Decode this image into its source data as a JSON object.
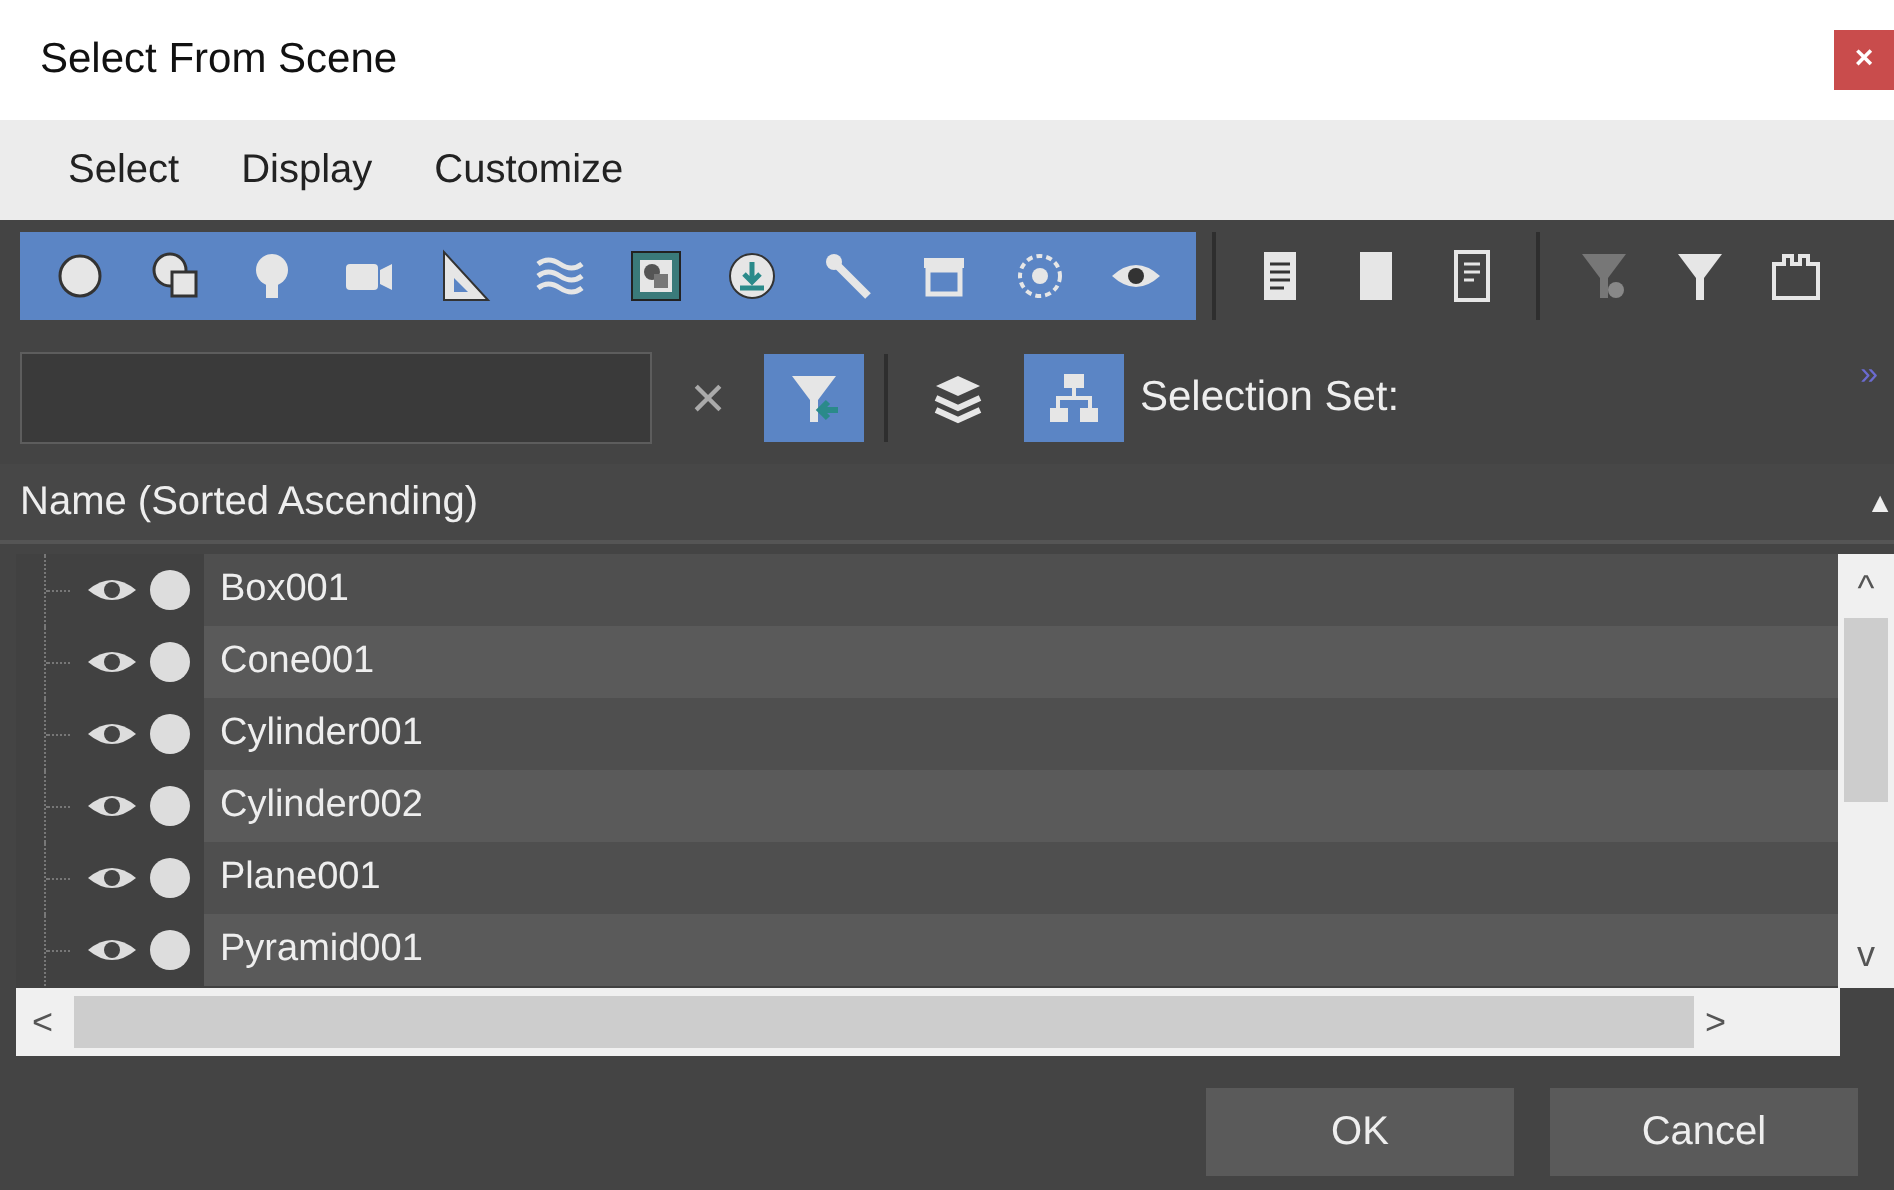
{
  "window": {
    "title": "Select From Scene",
    "close": "×"
  },
  "menu": [
    {
      "label": "Select"
    },
    {
      "label": "Display"
    },
    {
      "label": "Customize"
    }
  ],
  "type_filters": [
    {
      "selected": true
    },
    {
      "selected": true
    },
    {
      "selected": true
    },
    {
      "selected": true
    },
    {
      "selected": true
    },
    {
      "selected": true
    },
    {
      "selected": true
    },
    {
      "selected": true
    },
    {
      "selected": true
    },
    {
      "selected": true
    },
    {
      "selected": true
    },
    {
      "selected": true
    }
  ],
  "display_tools": [
    {
      "selected": false
    },
    {
      "selected": false
    },
    {
      "selected": false
    }
  ],
  "filter_tools": [
    {
      "selected": false
    },
    {
      "selected": false
    },
    {
      "selected": false
    }
  ],
  "search_tools": [
    {
      "kind": "clear",
      "label": "×",
      "selected": false
    },
    {
      "kind": "filter",
      "selected": true
    },
    {
      "kind": "layers",
      "selected": false
    },
    {
      "kind": "hierarchy",
      "selected": true
    }
  ],
  "selection_set_label": "Selection Set:",
  "overflow": "»",
  "column": {
    "title": "Name (Sorted Ascending)",
    "sort_arrow": "▲"
  },
  "rows": [
    {
      "name": "Box001",
      "visible": true
    },
    {
      "name": "Cone001",
      "visible": true
    },
    {
      "name": "Cylinder001",
      "visible": true
    },
    {
      "name": "Cylinder002",
      "visible": true
    },
    {
      "name": "Plane001",
      "visible": true
    },
    {
      "name": "Pyramid001",
      "visible": true
    }
  ],
  "scroll": {
    "up": "^",
    "down": "v",
    "left": "<",
    "right": ">"
  },
  "buttons": [
    {
      "label": "OK"
    },
    {
      "label": "Cancel"
    }
  ]
}
